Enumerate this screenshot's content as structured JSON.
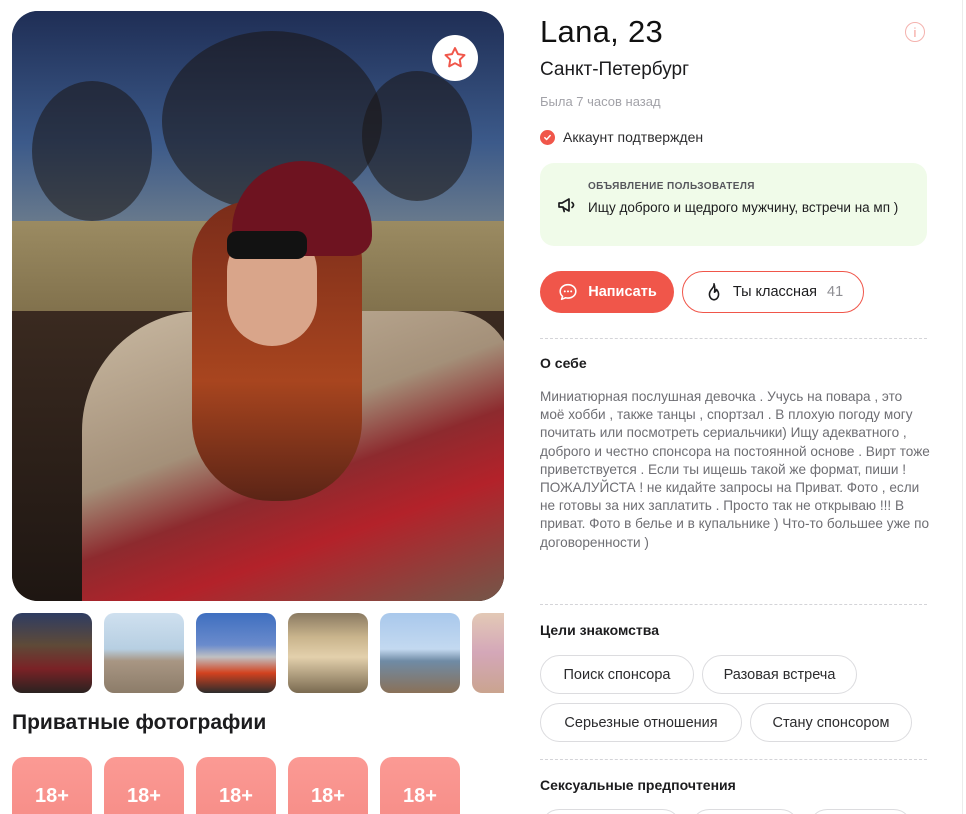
{
  "profile": {
    "name_age": "Lana, 23",
    "city": "Санкт-Петербург",
    "last_seen": "Была 7 часов назад",
    "verified_label": "Аккаунт подтвержден"
  },
  "announcement": {
    "label": "ОБЪЯВЛЕНИЕ ПОЛЬЗОВАТЕЛЯ",
    "text": "Ищу доброго и щедрого мужчину, встречи на мп )"
  },
  "actions": {
    "write_label": "Написать",
    "like_label": "Ты классная",
    "like_count": "41"
  },
  "about": {
    "title": "О себе",
    "text": "Миниатюрная послушная девочка . Учусь на повара , это моё хобби , также танцы , спортзал . В плохую погоду могу почитать или посмотреть сериальчики) Ищу адекватного , доброго и честно спонсора на постоянной основе . Вирт тоже приветствуется . Если ты ищешь такой же формат, пиши ! ПОЖАЛУЙСТА ! не кидайте запросы на Приват. Фото , если не готовы за них заплатить . Просто так не открываю !!! В приват. Фото в белье и в купальнике ) Что-то большее уже по договоренности )"
  },
  "goals": {
    "title": "Цели знакомства",
    "items": [
      "Поиск спонсора",
      "Разовая встреча",
      "Серьезные отношения",
      "Стану спонсором"
    ]
  },
  "preferences": {
    "title": "Сексуальные предпочтения"
  },
  "private_photos": {
    "title": "Приватные фотографии",
    "tiles": [
      "18+",
      "18+",
      "18+",
      "18+",
      "18+"
    ]
  },
  "icons": {
    "favorite": "star-icon",
    "info": "info-icon",
    "verified": "check-circle-icon",
    "announcement": "megaphone-icon",
    "write": "chat-bubble-icon",
    "like": "flame-icon"
  },
  "colors": {
    "accent": "#f0564a",
    "announcement_bg": "#f0fbe9",
    "private_tile": "#f58a85"
  }
}
